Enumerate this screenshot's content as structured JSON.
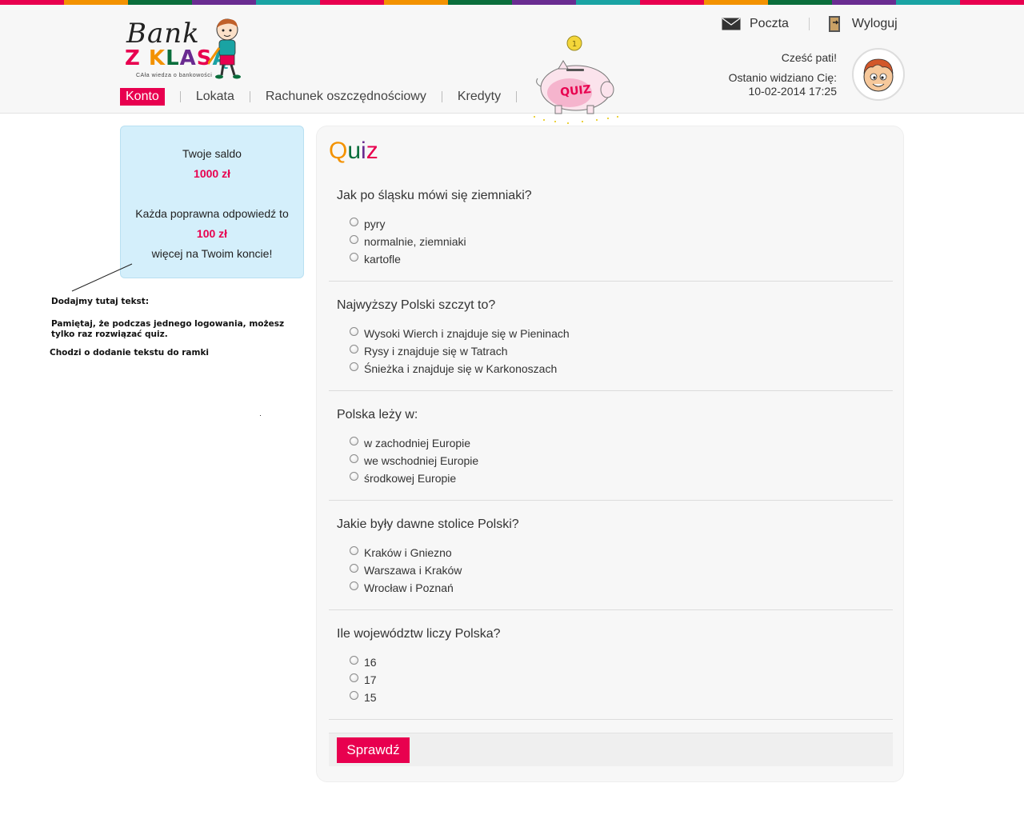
{
  "colors": {
    "accent": "#e8004f",
    "strip": [
      "#e8004f",
      "#f39200",
      "#0a6e3c",
      "#6a2c91",
      "#1aa3a3",
      "#e8004f",
      "#f39200",
      "#0a6e3c",
      "#6a2c91",
      "#1aa3a3",
      "#e8004f",
      "#f39200",
      "#0a6e3c",
      "#6a2c91",
      "#1aa3a3",
      "#e8004f"
    ],
    "info_box": "#d4effb"
  },
  "logo": {
    "bank": "Bank",
    "zklasa": "Z KLASĄ",
    "tagline": "CAła wiedza o bankowości"
  },
  "nav": {
    "items": [
      {
        "label": "Konto",
        "active": true
      },
      {
        "label": "Lokata",
        "active": false
      },
      {
        "label": "Rachunek oszczędnościowy",
        "active": false
      },
      {
        "label": "Kredyty",
        "active": false
      }
    ]
  },
  "piggy": {
    "label": "QUIZ"
  },
  "top_links": {
    "mail": {
      "label": "Poczta",
      "icon": "envelope-icon"
    },
    "logout": {
      "label": "Wyloguj",
      "icon": "door-exit-icon"
    }
  },
  "user": {
    "greeting": "Cześć pati!",
    "last_seen_label": "Ostanio widziano Cię:",
    "last_seen_value": "10-02-2014 17:25",
    "avatar_icon": "boy-avatar-icon"
  },
  "saldo": {
    "label": "Twoje saldo",
    "value": "1000 zł",
    "reward_label": "Każda poprawna odpowiedź to",
    "reward_value": "100 zł",
    "reward_suffix": "więcej na Twoim koncie!"
  },
  "note": {
    "line1": "Dodajmy tutaj tekst:",
    "line2a": "Pamiętaj, że podczas jednego logowania, możesz",
    "line2b": "tylko raz rozwiązać quiz.",
    "line3": "Chodzi o dodanie tekstu do ramki"
  },
  "quiz": {
    "title_q": "Q",
    "title_u": "u",
    "title_i": "i",
    "title_z": "z",
    "questions": [
      {
        "text": "Jak po śląsku mówi się ziemniaki?",
        "options": [
          "pyry",
          "normalnie, ziemniaki",
          "kartofle"
        ]
      },
      {
        "text": "Najwyższy Polski szczyt to?",
        "options": [
          "Wysoki Wierch i znajduje się w Pieninach",
          "Rysy i znajduje się w Tatrach",
          "Śnieżka i znajduje się w Karkonoszach"
        ]
      },
      {
        "text": "Polska leży w:",
        "options": [
          "w zachodniej Europie",
          "we wschodniej Europie",
          "środkowej Europie"
        ]
      },
      {
        "text": "Jakie były dawne stolice Polski?",
        "options": [
          "Kraków i Gniezno",
          "Warszawa i Kraków",
          "Wrocław i Poznań"
        ]
      },
      {
        "text": "Ile województw liczy Polska?",
        "options": [
          "16",
          "17",
          "15"
        ]
      }
    ],
    "submit_label": "Sprawdź"
  }
}
